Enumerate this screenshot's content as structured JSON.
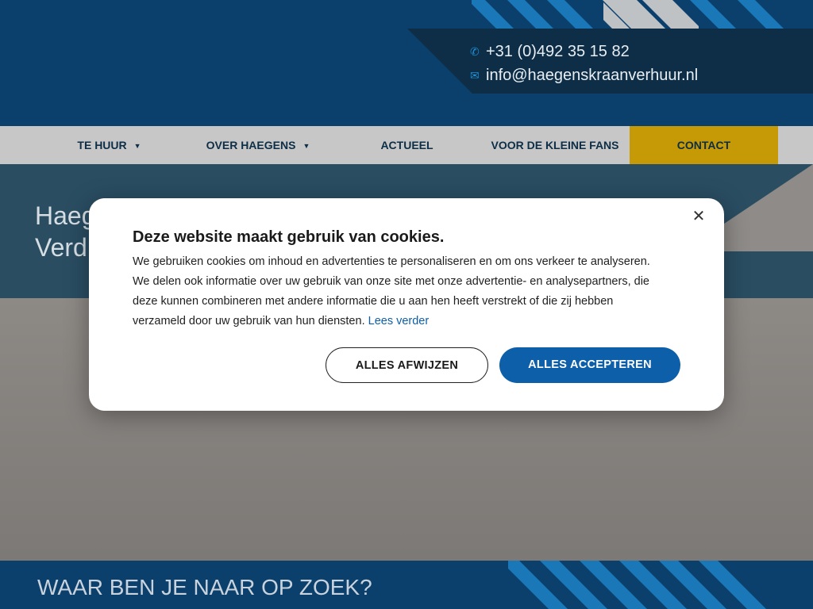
{
  "header": {
    "phone": "+31 (0)492 35 15 82",
    "email": "info@haegenskraanverhuur.nl",
    "icons": {
      "phone": "phone-icon",
      "email": "mail-icon"
    }
  },
  "nav": {
    "items": [
      {
        "label": "TE HUUR",
        "has_dropdown": true
      },
      {
        "label": "OVER HAEGENS",
        "has_dropdown": true
      },
      {
        "label": "ACTUEEL",
        "has_dropdown": false
      },
      {
        "label": "VOOR DE KLEINE FANS",
        "has_dropdown": false
      },
      {
        "label": "CONTACT",
        "has_dropdown": false
      }
    ]
  },
  "hero": {
    "title_line1": "Haeg",
    "title_line2": "Verd"
  },
  "bottom": {
    "title": "WAAR BEN JE NAAR OP ZOEK?"
  },
  "cookie": {
    "title": "Deze website maakt gebruik van cookies.",
    "body_lines": [
      "We gebruiken cookies om inhoud en advertenties te personaliseren en om ons verkeer te analyseren.",
      "We delen ook informatie over uw gebruik van onze site met onze advertentie- en analysepartners, die",
      "deze kunnen combineren met andere informatie die u aan hen heeft verstrekt of die zij hebben",
      "verzameld door uw gebruik van hun diensten."
    ],
    "link": "Lees verder",
    "reject_label": "ALLES AFWIJZEN",
    "accept_label": "ALLES ACCEPTEREN",
    "close_glyph": "✕"
  },
  "colors": {
    "brand_blue": "#0b3f6c",
    "dark_navy": "#0d2e46",
    "accent_yellow": "#c59a06",
    "button_blue": "#0c5fa8",
    "stripe_light": "#1a77b8",
    "stripe_gray": "#bfc2c4"
  }
}
